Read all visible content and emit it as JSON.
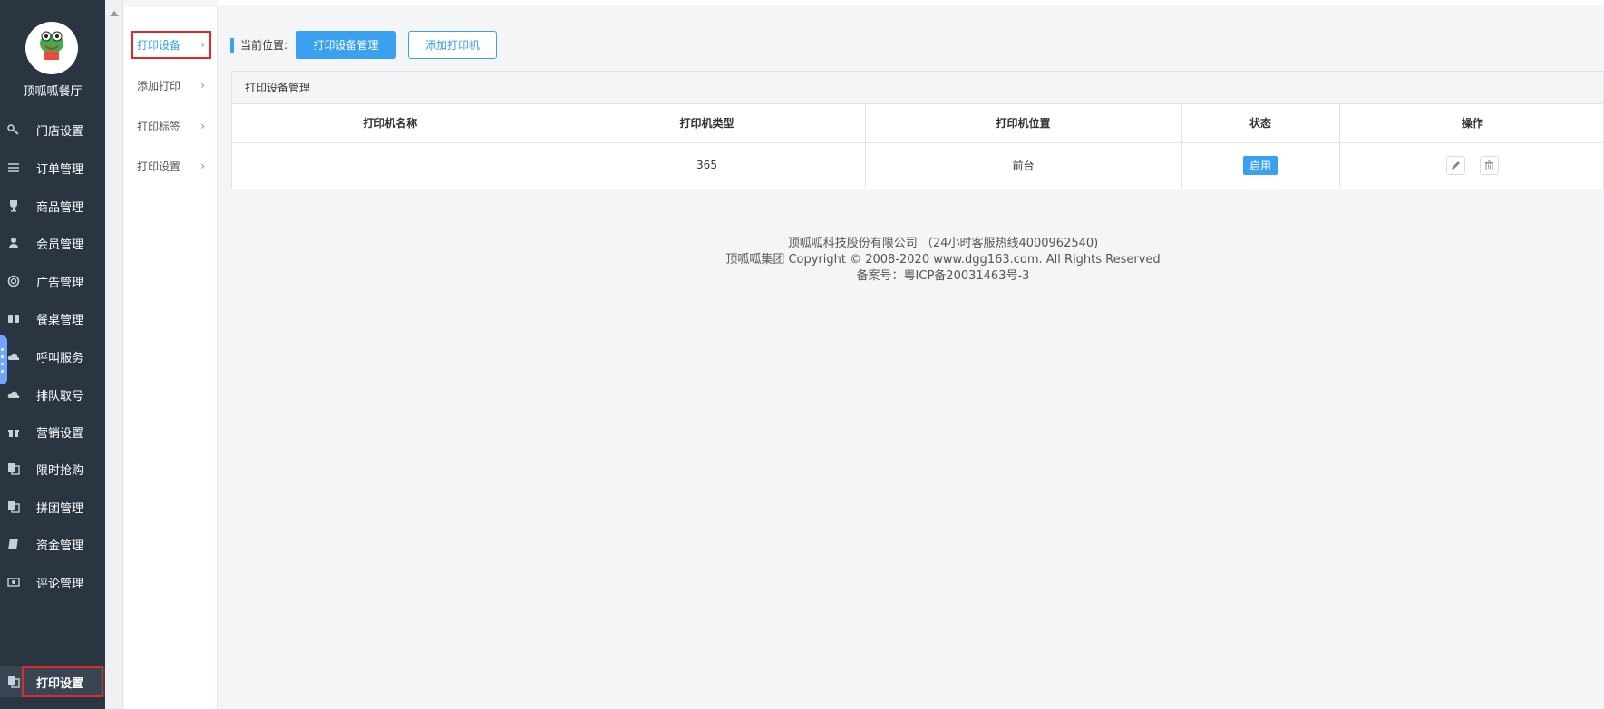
{
  "store": {
    "name": "顶呱呱餐厅",
    "logo_text": "顶呱呱餐厅"
  },
  "sidebar": {
    "items": [
      {
        "label": "门店设置",
        "icon": "key-icon"
      },
      {
        "label": "订单管理",
        "icon": "list-icon"
      },
      {
        "label": "商品管理",
        "icon": "trophy-icon"
      },
      {
        "label": "会员管理",
        "icon": "user-icon"
      },
      {
        "label": "广告管理",
        "icon": "lifebuoy-icon"
      },
      {
        "label": "餐桌管理",
        "icon": "binoculars-icon"
      },
      {
        "label": "呼叫服务",
        "icon": "cloud-icon"
      },
      {
        "label": "排队取号",
        "icon": "cloud-icon"
      },
      {
        "label": "营销设置",
        "icon": "gift-icon"
      },
      {
        "label": "限时抢购",
        "icon": "copy-icon"
      },
      {
        "label": "拼团管理",
        "icon": "copy-icon"
      },
      {
        "label": "资金管理",
        "icon": "book-icon"
      },
      {
        "label": "评论管理",
        "icon": "money-icon"
      },
      {
        "label": "打印设置",
        "icon": "copy-icon",
        "active": true
      }
    ]
  },
  "submenu": {
    "items": [
      {
        "label": "打印设备",
        "active": true
      },
      {
        "label": "添加打印"
      },
      {
        "label": "打印标签"
      },
      {
        "label": "打印设置"
      }
    ]
  },
  "breadcrumb": {
    "label": "当前位置:",
    "primary_button": "打印设备管理",
    "secondary_button": "添加打印机"
  },
  "panel": {
    "title": "打印设备管理",
    "columns": [
      "打印机名称",
      "打印机类型",
      "打印机位置",
      "状态",
      "操作"
    ],
    "rows": [
      {
        "name": "",
        "type": "365",
        "location": "前台",
        "status": "启用"
      }
    ]
  },
  "footer": {
    "line1": "顶呱呱科技股份有限公司 （24小时客服热线4000962540)",
    "line2": "顶呱呱集团 Copyright © 2008-2020 www.dgg163.com. All Rights Reserved",
    "line3": "备案号：粤ICP备20031463号-3"
  },
  "colors": {
    "accent": "#3aa1f0",
    "sidebar_bg": "#2a3542",
    "highlight_red": "#e02a2a"
  }
}
